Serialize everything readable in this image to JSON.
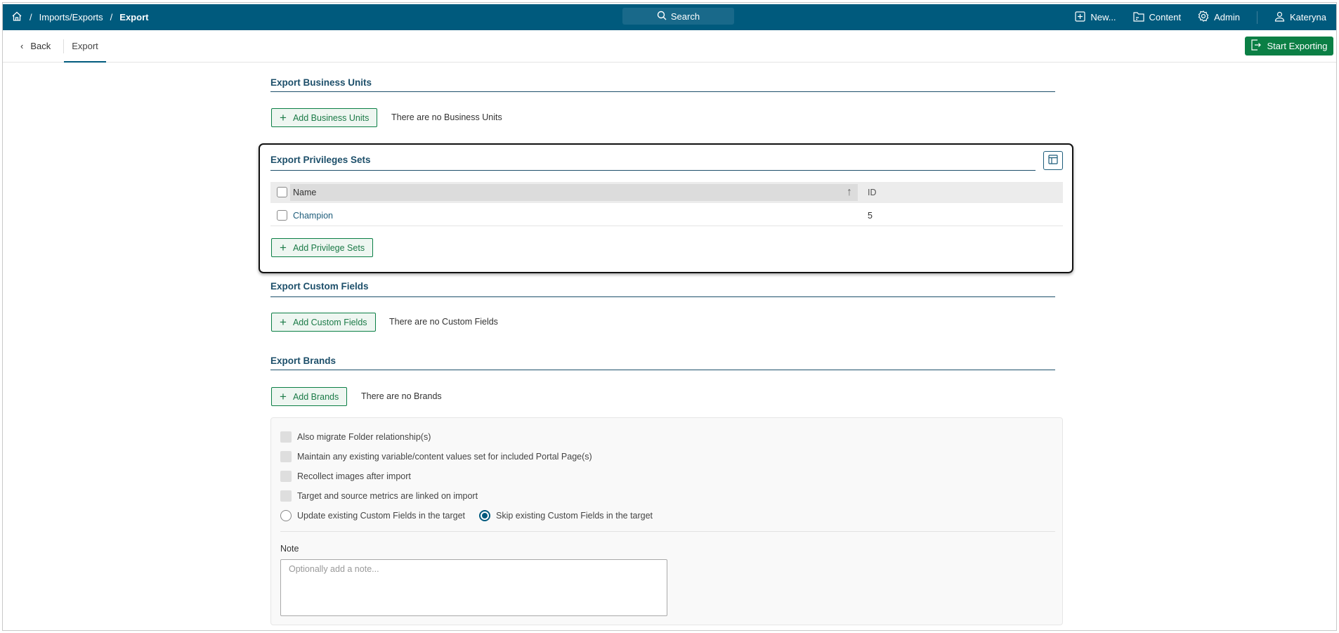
{
  "header": {
    "breadcrumb": [
      "Imports/Exports",
      "Export"
    ],
    "search_label": "Search",
    "nav": {
      "new": "New...",
      "content": "Content",
      "admin": "Admin",
      "user": "Kateryna"
    }
  },
  "subnav": {
    "back": "Back",
    "tab": "Export",
    "start_button": "Start Exporting"
  },
  "sections": {
    "business_units": {
      "title": "Export Business Units",
      "button": "Add Business Units",
      "empty": "There are no Business Units"
    },
    "privileges": {
      "title": "Export Privileges Sets",
      "columns": {
        "name": "Name",
        "id": "ID"
      },
      "rows": [
        {
          "name": "Champion",
          "id": "5"
        }
      ],
      "button": "Add Privilege Sets"
    },
    "custom_fields": {
      "title": "Export Custom Fields",
      "button": "Add Custom Fields",
      "empty": "There are no Custom Fields"
    },
    "brands": {
      "title": "Export Brands",
      "button": "Add Brands",
      "empty": "There are no Brands"
    }
  },
  "options": {
    "checkboxes": [
      "Also migrate Folder relationship(s)",
      "Maintain any existing variable/content values set for included Portal Page(s)",
      "Recollect images after import",
      "Target and source metrics are linked on import"
    ],
    "radio_update": "Update existing Custom Fields in the target",
    "radio_skip": "Skip existing Custom Fields in the target",
    "selected": "skip",
    "note_label": "Note",
    "note_placeholder": "Optionally add a note..."
  },
  "colors": {
    "brand": "#005a7d",
    "accent_green": "#0b7f45"
  }
}
